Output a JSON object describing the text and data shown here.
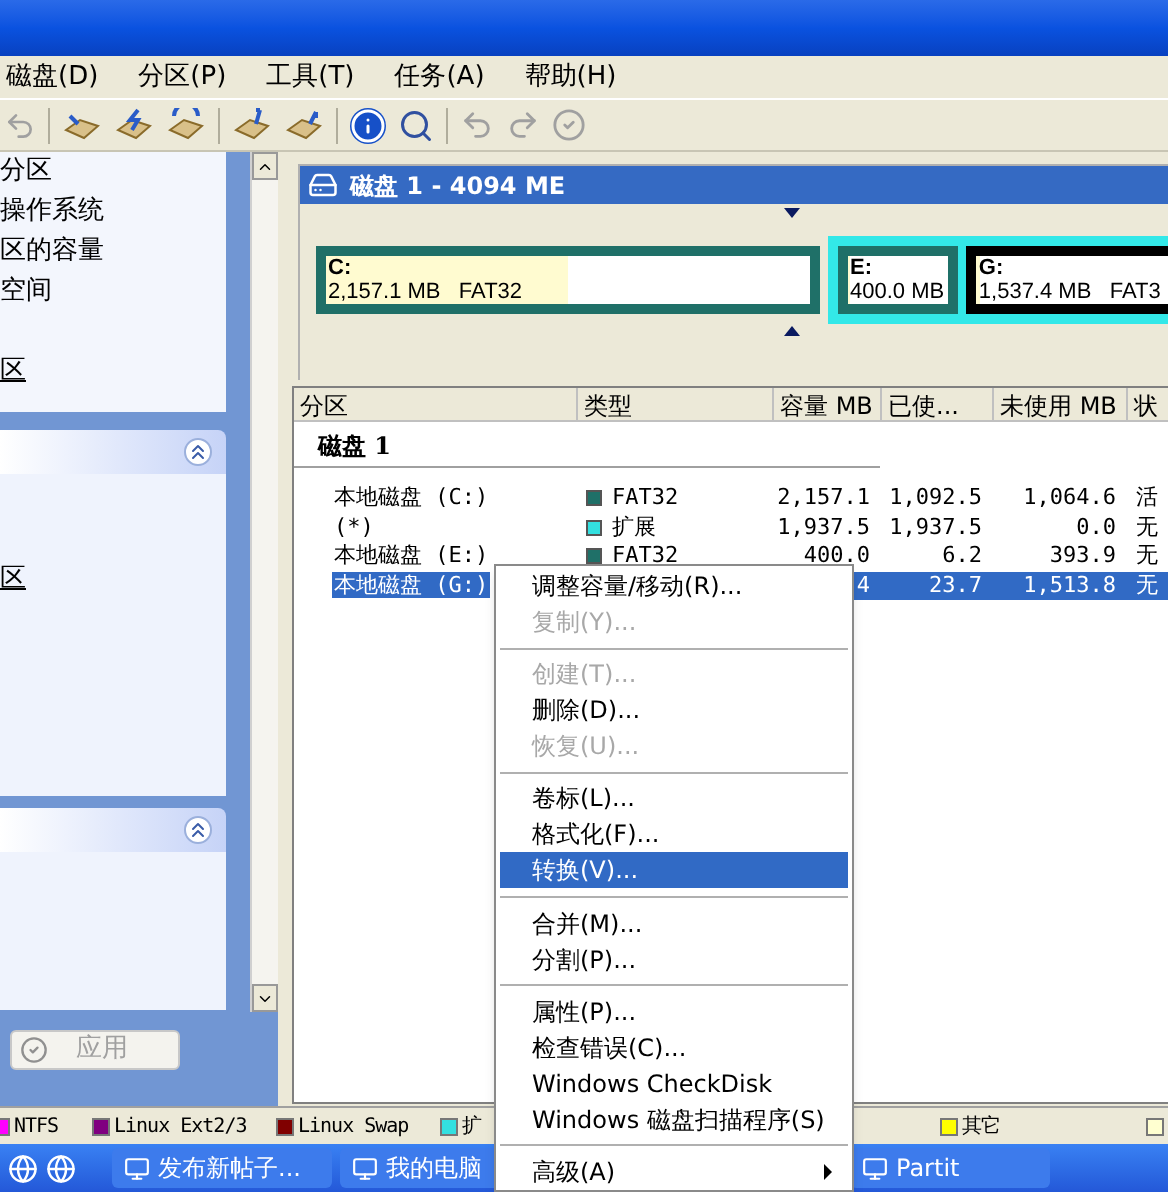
{
  "menu_bar": [
    "磁盘(D)",
    "分区(P)",
    "工具(T)",
    "任务(A)",
    "帮助(H)"
  ],
  "sidebar": {
    "panel_1": {
      "items": [
        "分区",
        "操作系统",
        "区的容量",
        "空间",
        "区"
      ]
    },
    "panel_2": {
      "items": [
        "区"
      ]
    },
    "apply_button": "应用"
  },
  "disk_map": {
    "title": "磁盘 1 - 4094 ME",
    "partitions": [
      {
        "kind": "primary",
        "letter": "C:",
        "size": "2,157.1 MB",
        "fs": "FAT32",
        "level": 0.5,
        "selected": false
      },
      {
        "kind": "extended",
        "children": [
          {
            "kind": "logical",
            "letter": "E:",
            "size": "400.0 MB",
            "level": 0.02,
            "selected": false
          },
          {
            "kind": "logical",
            "letter": "G:",
            "size": "1,537.4 MB",
            "fs": "FAT3",
            "level": 0.02,
            "selected": true
          }
        ]
      }
    ]
  },
  "partition_list": {
    "columns": [
      "分区",
      "类型",
      "容量 MB",
      "已使...",
      "未使用 MB",
      "状"
    ],
    "group": "磁盘 1",
    "rows": [
      {
        "name": "本地磁盘 (C:)",
        "color": "#1f7068",
        "type": "FAT32",
        "capacity": "2,157.1",
        "used": "1,092.5",
        "unused": "1,064.6",
        "status": "活",
        "selected": false
      },
      {
        "name": "(*)",
        "color": "#33e0e0",
        "type": "扩展",
        "capacity": "1,937.5",
        "used": "1,937.5",
        "unused": "0.0",
        "status": "无",
        "selected": false
      },
      {
        "name": "本地磁盘 (E:)",
        "color": "#1f7068",
        "type": "FAT32",
        "capacity": "400.0",
        "used": "6.2",
        "unused": "393.9",
        "status": "无",
        "selected": false
      },
      {
        "name": "本地磁盘 (G:)",
        "capacity": "4",
        "used": "23.7",
        "unused": "1,513.8",
        "status": "无",
        "selected": true
      }
    ]
  },
  "context_menu": [
    {
      "kind": "item",
      "label": "调整容量/移动(R)...",
      "disabled": false,
      "selected": false
    },
    {
      "kind": "item",
      "label": "复制(Y)...",
      "disabled": true,
      "selected": false
    },
    {
      "kind": "separator"
    },
    {
      "kind": "item",
      "label": "创建(T)...",
      "disabled": true,
      "selected": false
    },
    {
      "kind": "item",
      "label": "删除(D)...",
      "disabled": false,
      "selected": false
    },
    {
      "kind": "item",
      "label": "恢复(U)...",
      "disabled": true,
      "selected": false
    },
    {
      "kind": "separator"
    },
    {
      "kind": "item",
      "label": "卷标(L)...",
      "disabled": false,
      "selected": false
    },
    {
      "kind": "item",
      "label": "格式化(F)...",
      "disabled": false,
      "selected": false
    },
    {
      "kind": "item",
      "label": "转换(V)...",
      "disabled": false,
      "selected": true
    },
    {
      "kind": "separator"
    },
    {
      "kind": "item",
      "label": "合并(M)...",
      "disabled": false,
      "selected": false
    },
    {
      "kind": "item",
      "label": "分割(P)...",
      "disabled": false,
      "selected": false
    },
    {
      "kind": "separator"
    },
    {
      "kind": "item",
      "label": "属性(P)...",
      "disabled": false,
      "selected": false
    },
    {
      "kind": "item",
      "label": "检查错误(C)...",
      "disabled": false,
      "selected": false
    },
    {
      "kind": "item",
      "label": "Windows CheckDisk",
      "disabled": false,
      "selected": false
    },
    {
      "kind": "item",
      "label": "Windows 磁盘扫描程序(S)",
      "disabled": false,
      "selected": false
    },
    {
      "kind": "separator"
    },
    {
      "kind": "submenu",
      "label": "高级(A)",
      "disabled": false,
      "selected": false
    }
  ],
  "legend": [
    {
      "label": "NTFS",
      "color": "#ff00ff"
    },
    {
      "label": "Linux Ext2/3",
      "color": "#800080"
    },
    {
      "label": "Linux Swap",
      "color": "#800000"
    },
    {
      "label": "扩",
      "color": "#33e0e0"
    },
    {
      "label": "其它",
      "color": "#ffff00"
    },
    {
      "color": "#ffffd0"
    }
  ],
  "taskbar": {
    "tasks": [
      "发布新帖子...",
      "我的电脑",
      "Partit"
    ]
  }
}
